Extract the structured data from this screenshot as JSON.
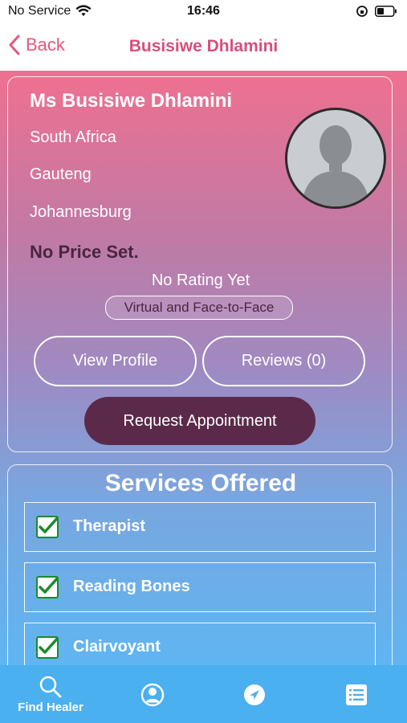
{
  "status_bar": {
    "carrier": "No Service",
    "time": "16:46"
  },
  "nav": {
    "back_label": "Back",
    "title": "Busisiwe  Dhlamini"
  },
  "profile": {
    "name": "Ms Busisiwe  Dhlamini",
    "country": "South Africa",
    "province": "Gauteng",
    "city": "Johannesburg",
    "price": "No Price Set.",
    "rating": "No Rating Yet",
    "mode": "Virtual and Face-to-Face",
    "view_profile_label": "View Profile",
    "reviews_label": "Reviews (0)",
    "request_label": "Request Appointment"
  },
  "services": {
    "title": "Services Offered",
    "items": [
      {
        "label": "Therapist",
        "checked": true
      },
      {
        "label": "Reading Bones",
        "checked": true
      },
      {
        "label": "Clairvoyant",
        "checked": true
      }
    ]
  },
  "tabs": [
    {
      "label": "Find Healer",
      "icon": "search-icon",
      "active": true
    },
    {
      "label": "",
      "icon": "profile-icon",
      "active": false
    },
    {
      "label": "",
      "icon": "navigation-icon",
      "active": false
    },
    {
      "label": "",
      "icon": "list-icon",
      "active": false
    }
  ],
  "colors": {
    "accent": "#e5567d",
    "tab_bar": "#4ab0f0",
    "request_button": "#5b2a4a",
    "check": "#1b8a2b"
  }
}
